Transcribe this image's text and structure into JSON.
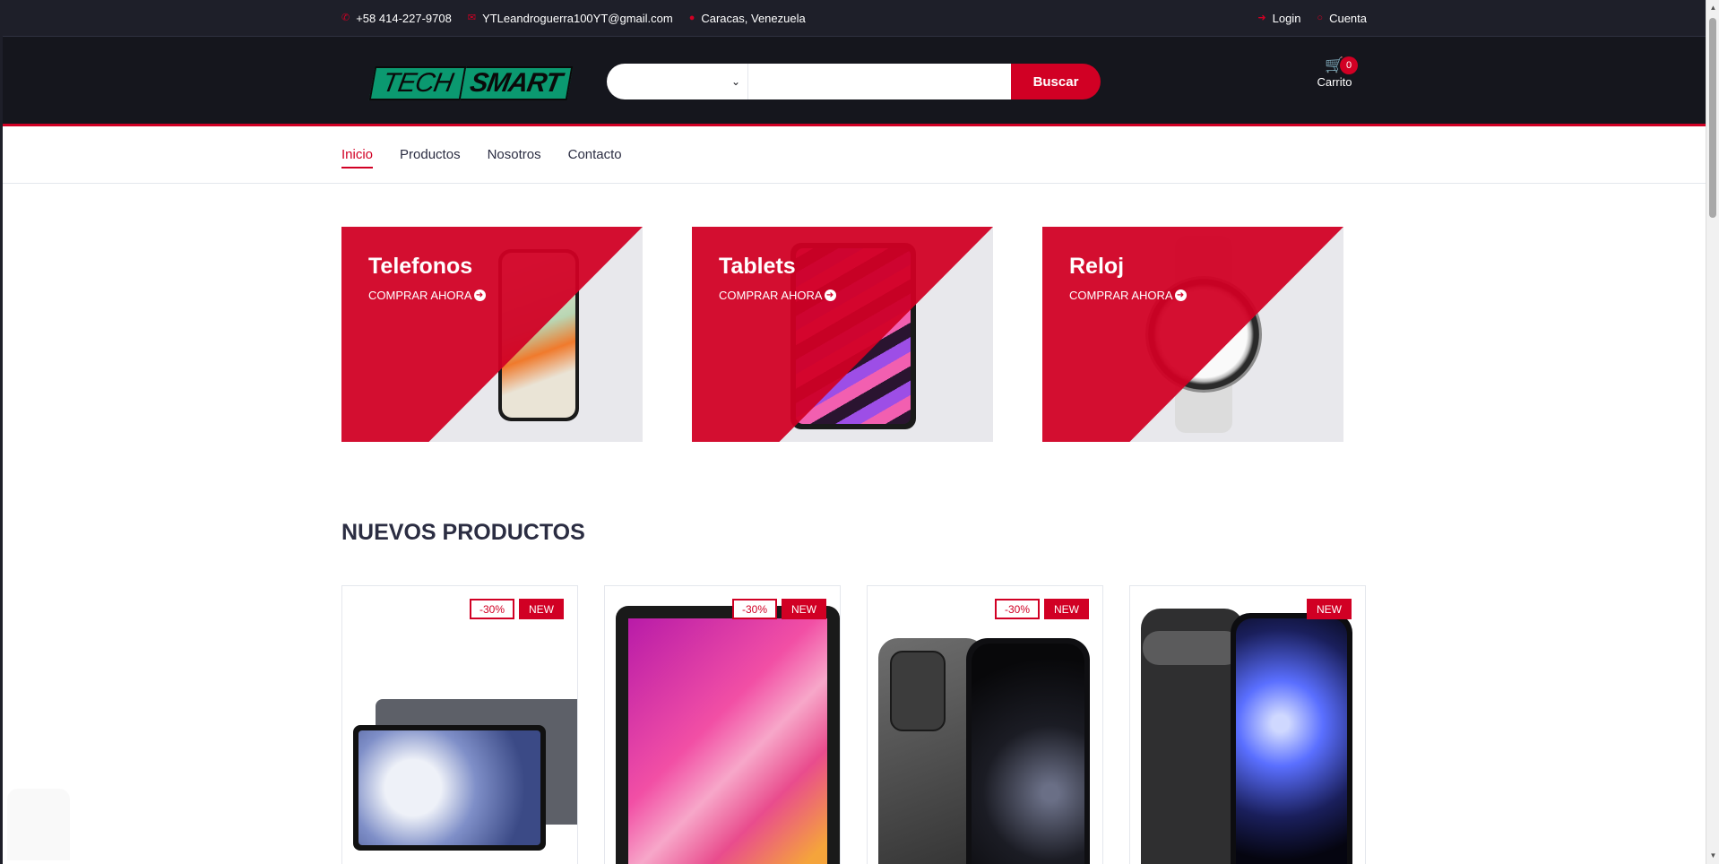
{
  "topbar": {
    "phone": "+58 414-227-9708",
    "email": "YTLeandroguerra100YT@gmail.com",
    "location": "Caracas, Venezuela",
    "login": "Login",
    "account": "Cuenta"
  },
  "header": {
    "logo_tech": "TECH",
    "logo_smart": "SMART",
    "search_category": "",
    "search_value": "",
    "search_button": "Buscar",
    "cart_label": "Carrito",
    "cart_qty": "0"
  },
  "nav": {
    "items": [
      {
        "label": "Inicio",
        "active": true
      },
      {
        "label": "Productos",
        "active": false
      },
      {
        "label": "Nosotros",
        "active": false
      },
      {
        "label": "Contacto",
        "active": false
      }
    ]
  },
  "categories": [
    {
      "title": "Telefonos",
      "cta": "COMPRAR AHORA"
    },
    {
      "title": "Tablets",
      "cta": "COMPRAR AHORA"
    },
    {
      "title": "Reloj",
      "cta": "COMPRAR AHORA"
    }
  ],
  "section": {
    "title": "NUEVOS PRODUCTOS"
  },
  "products": [
    {
      "sale": "-30%",
      "badge": "NEW"
    },
    {
      "sale": "-30%",
      "badge": "NEW"
    },
    {
      "sale": "-30%",
      "badge": "NEW"
    },
    {
      "sale": null,
      "badge": "NEW"
    }
  ],
  "colors": {
    "accent": "#d10024",
    "dark": "#15161d",
    "topbar": "#1e1f29"
  },
  "icons": [
    "phone-icon",
    "envelope-icon",
    "map-marker-icon",
    "sign-in-icon",
    "user-icon",
    "chevron-down-icon",
    "shopping-cart-icon",
    "arrow-circle-right-icon"
  ]
}
